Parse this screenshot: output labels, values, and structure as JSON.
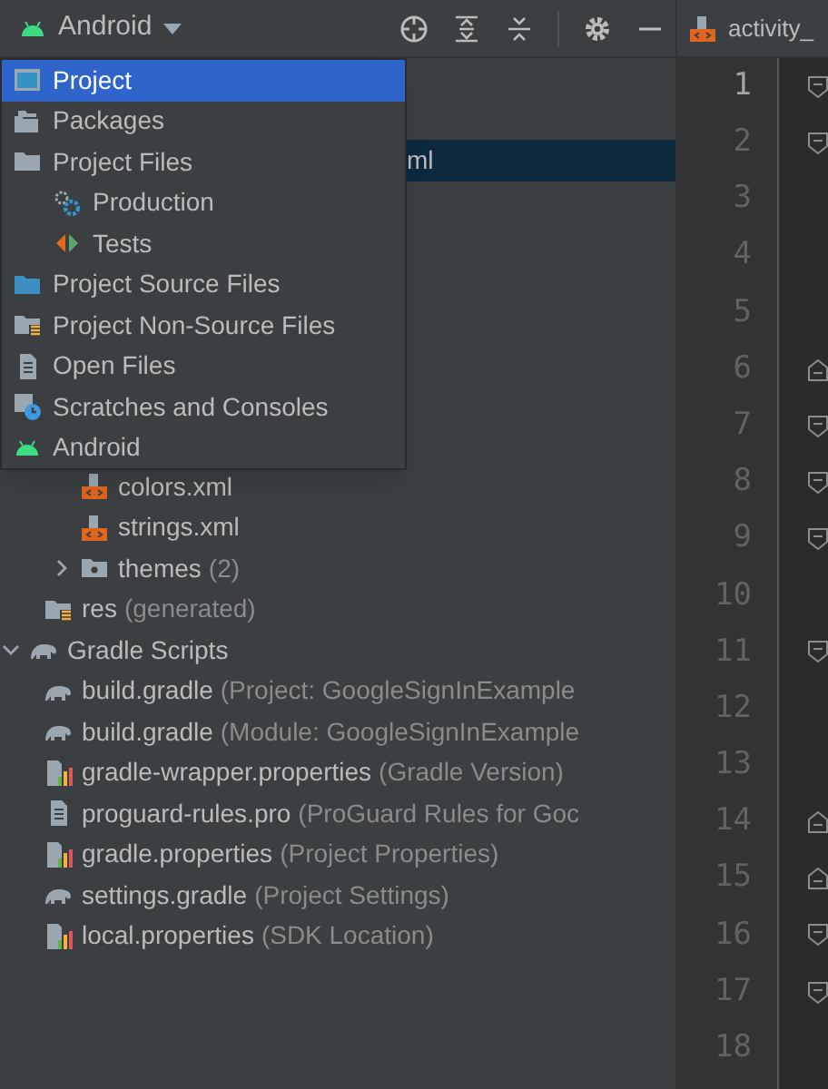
{
  "header": {
    "view": "Android"
  },
  "view_menu": [
    {
      "label": "Project",
      "kind": "project",
      "selected": true
    },
    {
      "label": "Packages",
      "kind": "packages",
      "selected": false
    },
    {
      "label": "Project Files",
      "kind": "folder",
      "selected": false,
      "children": [
        {
          "label": "Production",
          "kind": "gear",
          "selected": false
        },
        {
          "label": "Tests",
          "kind": "tests",
          "selected": false
        }
      ]
    },
    {
      "label": "Project Source Files",
      "kind": "source",
      "selected": false
    },
    {
      "label": "Project Non-Source Files",
      "kind": "nonsource",
      "selected": false
    },
    {
      "label": "Open Files",
      "kind": "file",
      "selected": false
    },
    {
      "label": "Scratches and Consoles",
      "kind": "scratch",
      "selected": false
    },
    {
      "label": "Android",
      "kind": "android",
      "selected": false
    }
  ],
  "selected_row": {
    "text": "ml",
    "selected": true
  },
  "tree": [
    {
      "children": [
        {
          "children": [
            {
              "label": "colors.xml",
              "kind": "xml"
            },
            {
              "label": "strings.xml",
              "kind": "xml"
            },
            {
              "label": "themes",
              "note": "(2)",
              "kind": "pkg",
              "expanded": false
            }
          ]
        },
        {
          "label": "res",
          "note": "(generated)",
          "kind": "res"
        }
      ]
    },
    {
      "label": "Gradle Scripts",
      "kind": "gradle",
      "expanded": true,
      "children": [
        {
          "label": "build.gradle",
          "note": "(Project: GoogleSignInExample",
          "kind": "gradle"
        },
        {
          "label": "build.gradle",
          "note": "(Module: GoogleSignInExample",
          "kind": "gradle"
        },
        {
          "label": "gradle-wrapper.properties",
          "note": "(Gradle Version)",
          "kind": "props"
        },
        {
          "label": "proguard-rules.pro",
          "note": "(ProGuard Rules for Goc",
          "kind": "file"
        },
        {
          "label": "gradle.properties",
          "note": "(Project Properties)",
          "kind": "props"
        },
        {
          "label": "settings.gradle",
          "note": "(Project Settings)",
          "kind": "gradle"
        },
        {
          "label": "local.properties",
          "note": "(SDK Location)",
          "kind": "props"
        }
      ]
    }
  ],
  "editor": {
    "tab": "activity_",
    "lines": [
      {
        "number": "1",
        "current": true,
        "kind": "start"
      },
      {
        "number": "2",
        "current": false,
        "kind": "start"
      },
      {
        "number": "3",
        "current": false
      },
      {
        "number": "4",
        "current": false
      },
      {
        "number": "5",
        "current": false
      },
      {
        "number": "6",
        "current": false,
        "kind": "end"
      },
      {
        "number": "7",
        "current": false,
        "kind": "start"
      },
      {
        "number": "8",
        "current": false,
        "kind": "start"
      },
      {
        "number": "9",
        "current": false,
        "kind": "start"
      },
      {
        "number": "10",
        "current": false
      },
      {
        "number": "11",
        "current": false,
        "kind": "start"
      },
      {
        "number": "12",
        "current": false
      },
      {
        "number": "13",
        "current": false
      },
      {
        "number": "14",
        "current": false,
        "kind": "end"
      },
      {
        "number": "15",
        "current": false,
        "kind": "end"
      },
      {
        "number": "16",
        "current": false,
        "kind": "start"
      },
      {
        "number": "17",
        "current": false,
        "kind": "start"
      },
      {
        "number": "18",
        "current": false
      }
    ]
  }
}
